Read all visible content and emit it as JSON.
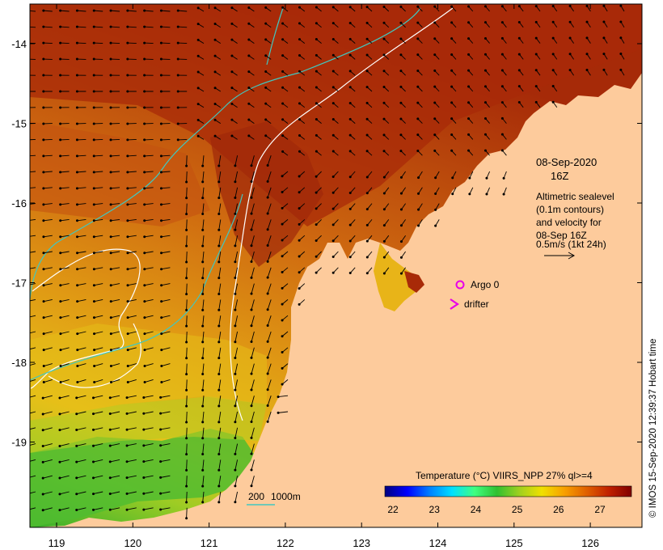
{
  "map": {
    "axes": {
      "x_ticks": [
        "119",
        "120",
        "121",
        "122",
        "123",
        "124",
        "125",
        "126"
      ],
      "y_ticks": [
        "-14",
        "-15",
        "-16",
        "-17",
        "-18",
        "-19"
      ]
    },
    "annotation": {
      "date": "08-Sep-2020",
      "hour": "16Z",
      "desc_line1": "Altimetric sealevel",
      "desc_line2": "(0.1m contours)",
      "desc_line3": "and velocity for",
      "desc_line4": "08-Sep 16Z",
      "scale_label": "0.5m/s (1kt 24h)"
    },
    "markers": {
      "argo_label": "Argo 0",
      "drifter_label": "drifter",
      "argo_color": "#e800e8",
      "drifter_color": "#e800e8"
    },
    "isobath_legend": {
      "label_200": "200",
      "label_1000": "1000m",
      "color_200": "#ffffff",
      "color_1000": "#40c8c0"
    },
    "colorbar": {
      "title": "Temperature (°C) VIIRS_NPP 27% ql>=4",
      "ticks": [
        "22",
        "23",
        "24",
        "25",
        "26",
        "27"
      ],
      "colors": [
        "#00007f",
        "#0000ff",
        "#0080ff",
        "#00e0ff",
        "#40ff80",
        "#30c030",
        "#a0d020",
        "#f0e000",
        "#f8a000",
        "#e06000",
        "#c02000",
        "#800000"
      ]
    },
    "credit": "© IMOS 15-Sep-2020 12:39:37 Hobart time",
    "colors": {
      "land": "#fdcb9c",
      "sea_warm": "#a82a08",
      "sea_mid": "#d46a10",
      "sea_cool": "#e8b418",
      "sea_green": "#40b830",
      "arrow": "#000000",
      "frame": "#000000"
    }
  }
}
